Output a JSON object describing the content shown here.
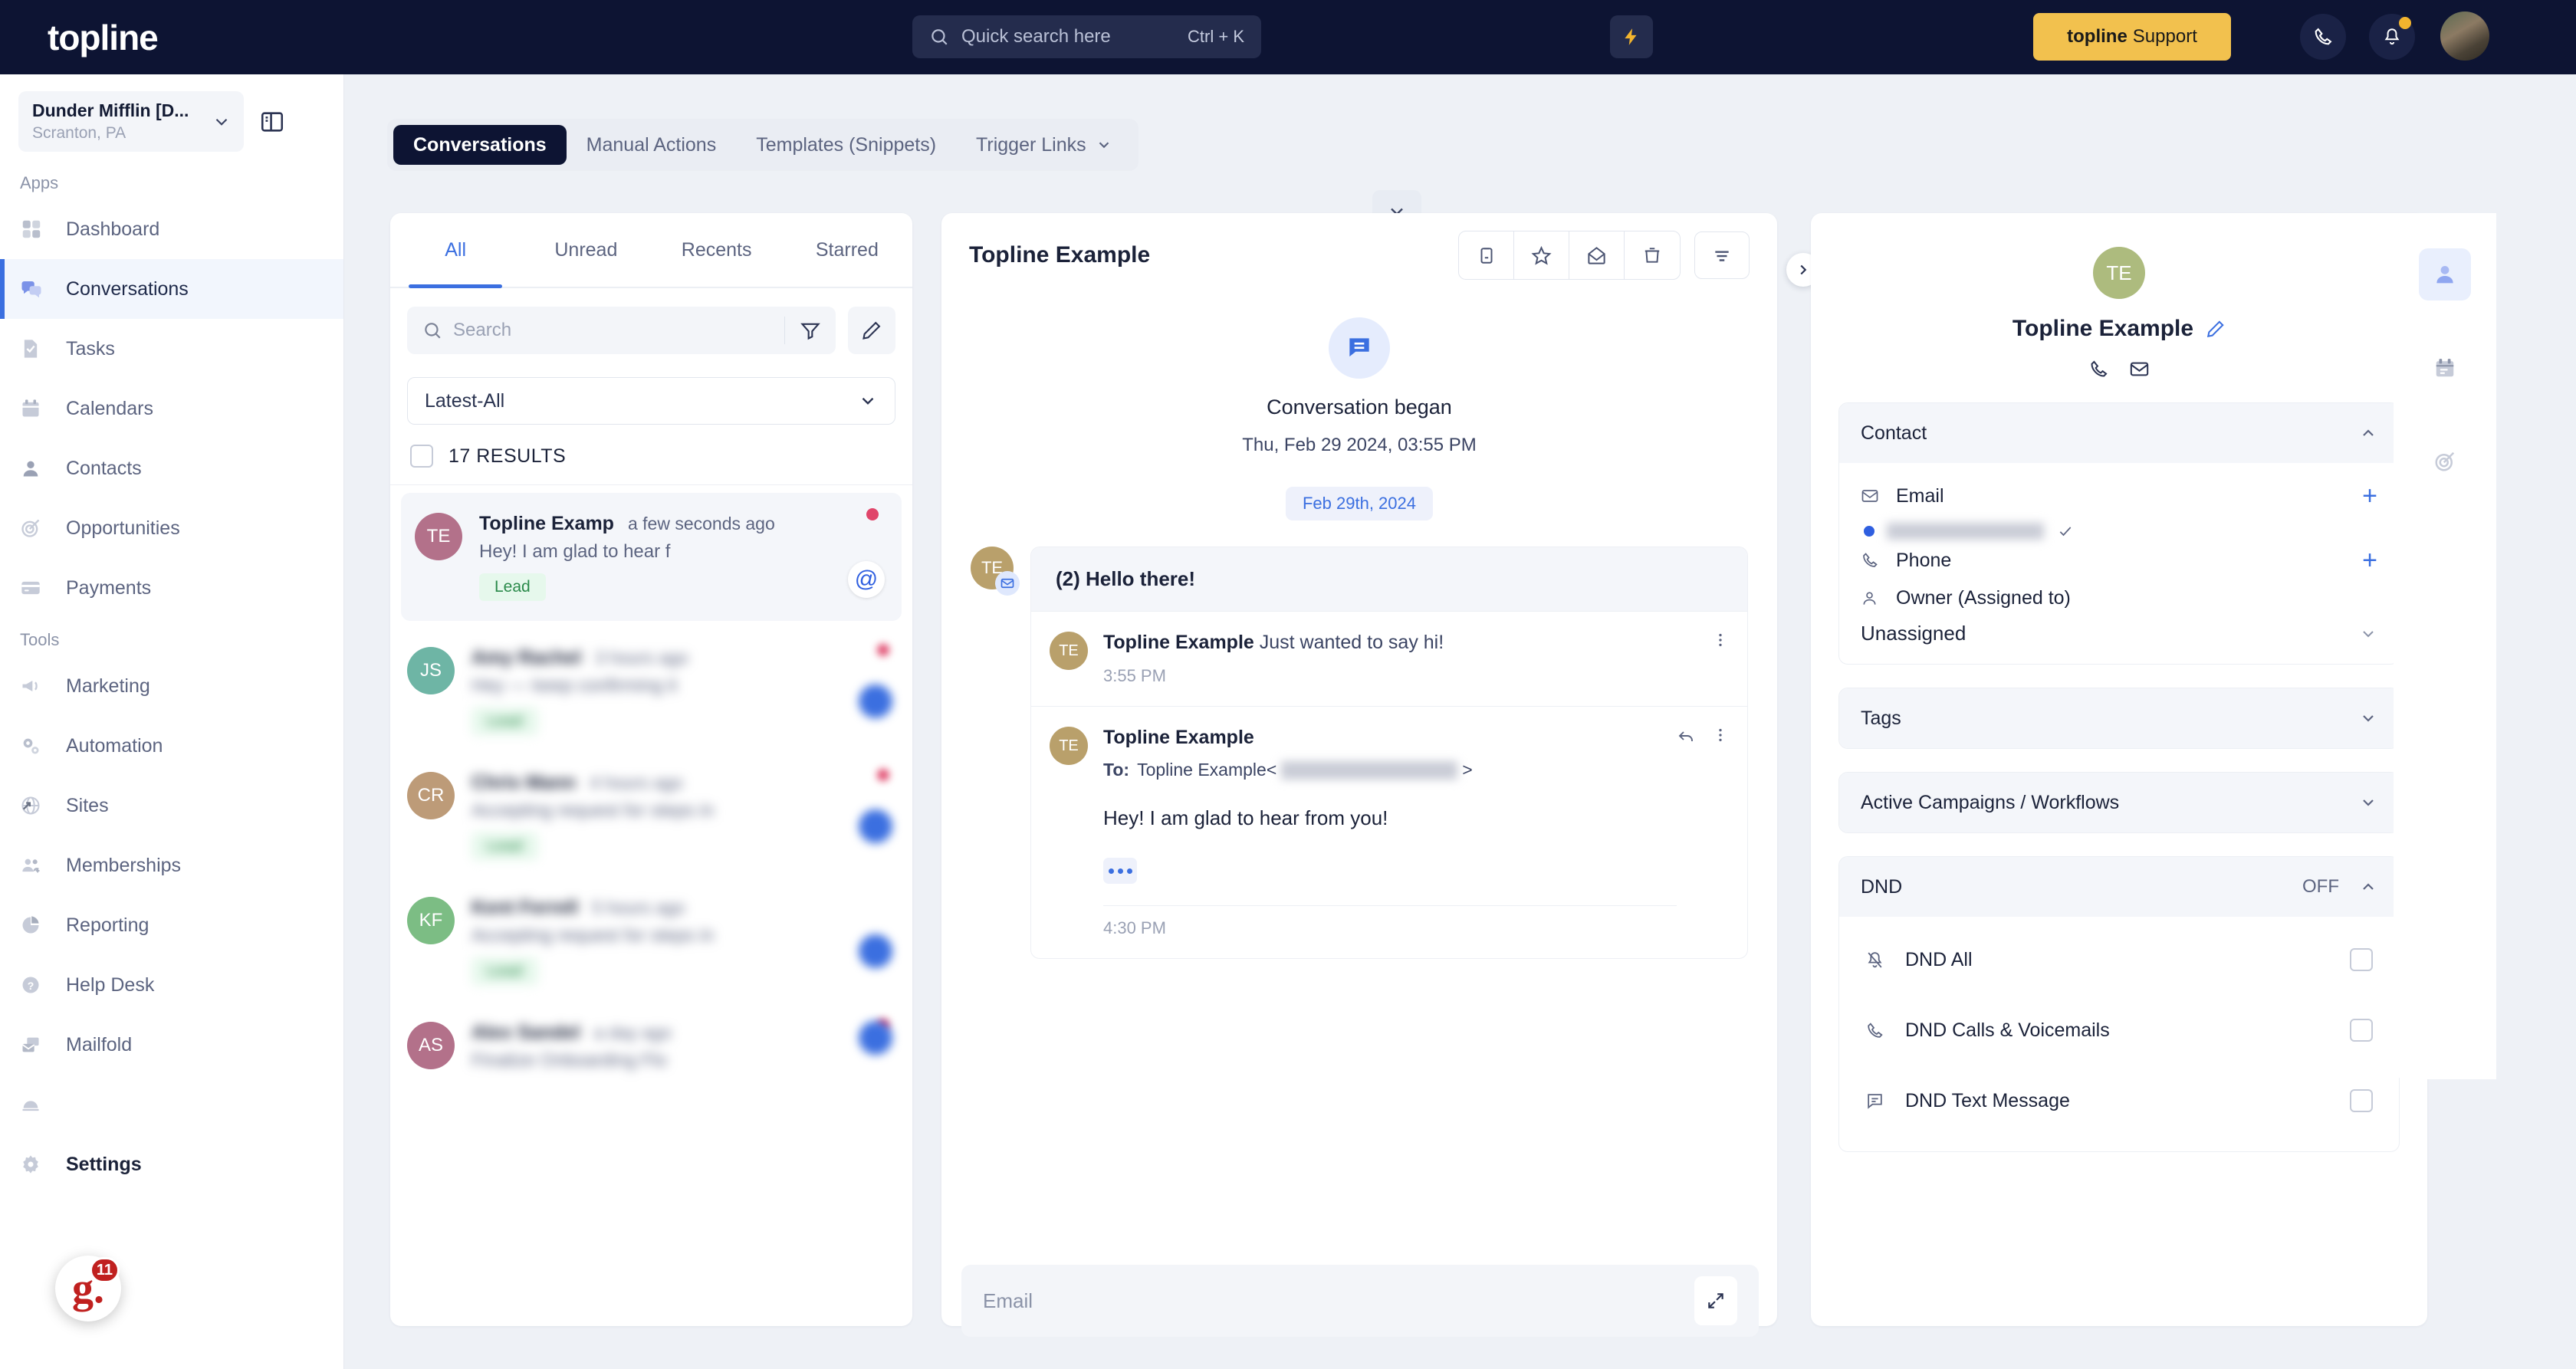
{
  "topbar": {
    "logo": "topline",
    "search_placeholder": "Quick search here",
    "search_shortcut": "Ctrl + K",
    "bolt_icon": "lightning-bolt-icon",
    "support_button_brand": "topline",
    "support_button_label": "Support",
    "call_icon": "phone-icon",
    "bell_icon": "bell-icon",
    "avatar": "user-avatar",
    "bg_color": "#0d1433",
    "accent_color": "#f2c14e"
  },
  "sidebar": {
    "location_name": "Dunder Mifflin [D...",
    "location_sub": "Scranton, PA",
    "collapse_icon": "panel-collapse-icon",
    "sections": [
      {
        "label": "Apps",
        "items": [
          {
            "label": "Dashboard",
            "icon": "dashboard-icon"
          },
          {
            "label": "Conversations",
            "icon": "conversations-icon",
            "active": true
          },
          {
            "label": "Tasks",
            "icon": "tasks-icon"
          },
          {
            "label": "Calendars",
            "icon": "calendar-icon"
          },
          {
            "label": "Contacts",
            "icon": "contacts-icon"
          },
          {
            "label": "Opportunities",
            "icon": "target-icon"
          },
          {
            "label": "Payments",
            "icon": "credit-card-icon"
          }
        ]
      },
      {
        "label": "Tools",
        "items": [
          {
            "label": "Marketing",
            "icon": "megaphone-icon"
          },
          {
            "label": "Automation",
            "icon": "gears-icon"
          },
          {
            "label": "Sites",
            "icon": "globe-icon"
          },
          {
            "label": "Memberships",
            "icon": "members-icon"
          },
          {
            "label": "Reporting",
            "icon": "pie-chart-icon"
          },
          {
            "label": "Help Desk",
            "icon": "question-circle-icon"
          },
          {
            "label": "Mailfold",
            "icon": "mail-stack-icon"
          },
          {
            "label": "Settings",
            "icon": "gear-icon",
            "bold": true
          }
        ]
      }
    ],
    "badge_letter": "g.",
    "badge_count": "11",
    "badge_color": "#c0201f"
  },
  "tabs": [
    {
      "label": "Conversations",
      "active": true
    },
    {
      "label": "Manual Actions",
      "active": false
    },
    {
      "label": "Templates (Snippets)",
      "active": false
    },
    {
      "label": "Trigger Links",
      "active": false,
      "chevron": true
    }
  ],
  "list_panel": {
    "tabs": [
      {
        "label": "All",
        "active": true
      },
      {
        "label": "Unread",
        "active": false
      },
      {
        "label": "Recents",
        "active": false
      },
      {
        "label": "Starred",
        "active": false
      }
    ],
    "search_placeholder": "Search",
    "filter_icon": "funnel-icon",
    "compose_icon": "pencil-icon",
    "sort_value": "Latest-All",
    "results_label": "17 RESULTS",
    "conversations": [
      {
        "initials": "TE",
        "avatar_color": "#b3718a",
        "name": "Topline Examp",
        "time": "a few seconds ago",
        "preview": "Hey! I am glad to hear f",
        "tag": "Lead",
        "channel_icon": "at-icon",
        "unread": true,
        "selected": true,
        "blurred": false
      },
      {
        "initials": "JS",
        "avatar_color": "#6eb5a5",
        "name": "",
        "time": "",
        "preview": "",
        "tag": "",
        "blurred": true
      },
      {
        "initials": "CR",
        "avatar_color": "#bd9b78",
        "name": "",
        "time": "",
        "preview": "",
        "tag": "",
        "blurred": true
      },
      {
        "initials": "KF",
        "avatar_color": "#7cbd84",
        "name": "",
        "time": "",
        "preview": "",
        "tag": "",
        "blurred": true
      },
      {
        "initials": "AS",
        "avatar_color": "#b3718a",
        "name": "",
        "time": "",
        "preview": "",
        "tag": "",
        "blurred": true
      }
    ]
  },
  "thread": {
    "title": "Topline Example",
    "collapse_icon": "chevron-down-icon",
    "actions": [
      {
        "icon": "archive-icon"
      },
      {
        "icon": "star-icon"
      },
      {
        "icon": "envelope-open-icon"
      },
      {
        "icon": "trash-icon"
      }
    ],
    "filter_icon": "sort-filter-icon",
    "start_title": "Conversation began",
    "start_date": "Thu, Feb 29 2024, 03:55 PM",
    "date_chip": "Feb 29th, 2024",
    "subject": "(2) Hello there!",
    "messages": [
      {
        "initials": "TE",
        "sender": "Topline Example",
        "snippet": "Just wanted to say hi!",
        "time": "3:55 PM",
        "channel": "email-open-icon"
      },
      {
        "initials": "TE",
        "sender": "Topline Example",
        "to_label": "To:",
        "to_name": "Topline Example",
        "body": "Hey! I am glad to hear from you!",
        "time": "4:30 PM",
        "channel": "email-icon",
        "reply_icon": "reply-icon",
        "more_icon": "more-vertical-icon"
      }
    ],
    "composer_placeholder": "Email",
    "expand_icon": "expand-icon",
    "side_toggle_icon": "chevron-right-icon"
  },
  "right_panel": {
    "avatar_initials": "TE",
    "avatar_color": "#adbb7e",
    "contact_name": "Topline Example",
    "edit_icon": "pencil-edit-icon",
    "quick_icons": [
      {
        "icon": "phone-icon"
      },
      {
        "icon": "envelope-icon"
      }
    ],
    "contact_card": {
      "title": "Contact",
      "collapse_icon": "chevron-up-icon",
      "email_label": "Email",
      "email_add_icon": "plus-icon",
      "email_verified_icon": "check-icon",
      "phone_label": "Phone",
      "phone_add_icon": "plus-icon",
      "owner_label": "Owner (Assigned to)",
      "owner_value": "Unassigned",
      "owner_chevron": "chevron-down-icon"
    },
    "tags_card": {
      "title": "Tags",
      "chevron": "chevron-down-icon"
    },
    "campaigns_card": {
      "title": "Active Campaigns / Workflows",
      "chevron": "chevron-down-icon"
    },
    "dnd_card": {
      "title": "DND",
      "status": "OFF",
      "chevron": "chevron-up-icon",
      "rows": [
        {
          "label": "DND All",
          "icon": "bell-off-icon",
          "checked": false
        },
        {
          "label": "DND Calls & Voicemails",
          "icon": "phone-icon",
          "checked": false
        },
        {
          "label": "DND Text Message",
          "icon": "message-icon",
          "checked": false
        }
      ]
    },
    "rail": [
      {
        "icon": "person-icon",
        "active": true
      },
      {
        "icon": "calendar-icon",
        "active": false
      },
      {
        "icon": "target-icon",
        "active": false
      }
    ]
  }
}
